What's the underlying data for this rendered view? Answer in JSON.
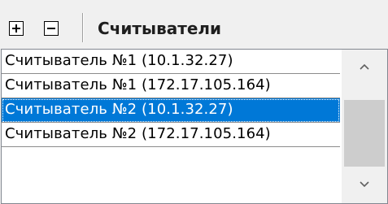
{
  "toolbar": {
    "title": "Считыватели",
    "expand_icon": "plus-square-icon",
    "collapse_icon": "minus-square-icon"
  },
  "readers": {
    "items": [
      {
        "label": "Считыватель №1 (10.1.32.27)",
        "selected": false
      },
      {
        "label": "Считыватель №1 (172.17.105.164)",
        "selected": false
      },
      {
        "label": "Считыватель №2 (10.1.32.27)",
        "selected": true
      },
      {
        "label": "Считыватель №2 (172.17.105.164)",
        "selected": false
      }
    ]
  },
  "scrollbar": {
    "up_icon": "chevron-up-icon",
    "down_icon": "chevron-down-icon"
  },
  "colors": {
    "selection": "#0078d7",
    "selection_text": "#ffffff",
    "toolbar_bg": "#f0f0f0"
  }
}
